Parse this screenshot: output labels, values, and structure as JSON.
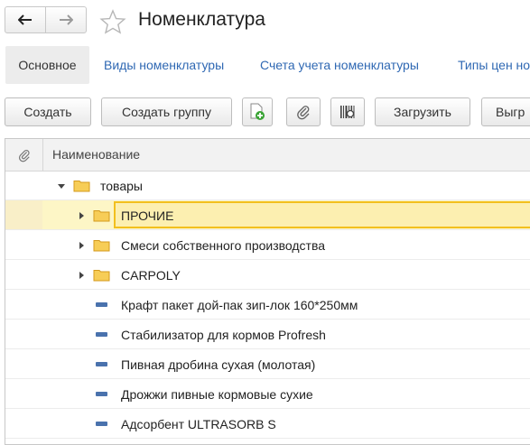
{
  "window": {
    "title": "Номенклатура"
  },
  "tabs": [
    {
      "label": "Основное",
      "active": true
    },
    {
      "label": "Виды номенклатуры",
      "active": false
    },
    {
      "label": "Счета учета номенклатуры",
      "active": false
    },
    {
      "label": "Типы цен но",
      "active": false
    }
  ],
  "toolbar": {
    "create_label": "Создать",
    "create_group_label": "Создать группу",
    "load_label": "Загрузить",
    "extra_label": "Выгр"
  },
  "table": {
    "header": {
      "name_column": "Наименование"
    },
    "rows": [
      {
        "label": "товары",
        "kind": "folder",
        "expanded": true,
        "selected": false
      },
      {
        "label": "ПРОЧИЕ",
        "kind": "folder",
        "expanded": false,
        "selected": true
      },
      {
        "label": "Смеси собственного производства",
        "kind": "folder",
        "expanded": false,
        "selected": false
      },
      {
        "label": "CARPOLY",
        "kind": "folder",
        "expanded": false,
        "selected": false
      },
      {
        "label": "Крафт пакет дой-пак зип-лок 160*250мм",
        "kind": "item",
        "selected": false
      },
      {
        "label": "Стабилизатор для кормов Profresh",
        "kind": "item",
        "selected": false
      },
      {
        "label": "Пивная дробина сухая (молотая)",
        "kind": "item",
        "selected": false
      },
      {
        "label": "Дрожжи пивные кормовые сухие",
        "kind": "item",
        "selected": false
      },
      {
        "label": "Адсорбент ULTRASORB S",
        "kind": "item",
        "selected": false
      }
    ]
  },
  "colors": {
    "link": "#2f68b3",
    "selection_fill": "#fcefb0",
    "selection_border": "#f2c01e",
    "folder": "#f5c342",
    "item_icon": "#4a72ad",
    "add_icon": "#3aa335"
  },
  "icons": [
    "back-arrow-icon",
    "forward-arrow-icon",
    "favorite-star-icon",
    "add-copy-icon",
    "paperclip-icon",
    "barcode-search-icon",
    "folder-icon",
    "item-icon"
  ]
}
